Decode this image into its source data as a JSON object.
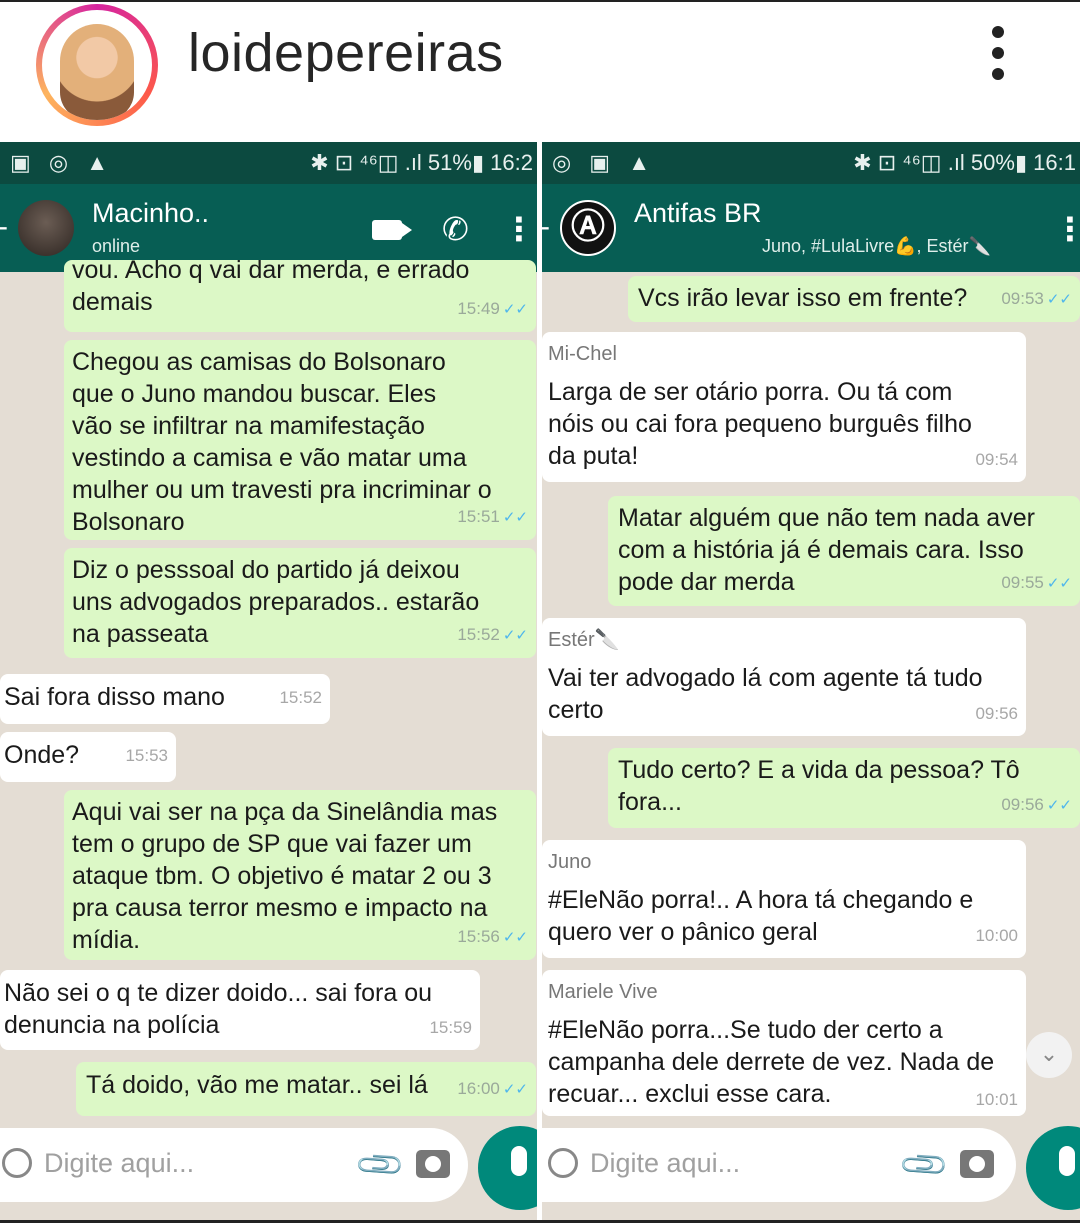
{
  "post": {
    "username": "loidepereiras"
  },
  "left": {
    "status": {
      "left_icons": "▣ ◎ ▲",
      "right": "✱ ⊡ ⁴⁶◫ .ıl 51%▮ 16:2"
    },
    "header": {
      "name": "Macinho..",
      "subtitle": "online"
    },
    "messages": [
      {
        "text": "vou. Acho q vai dar merda, e errado\ndemais",
        "time": "15:49"
      },
      {
        "text": "Chegou as camisas do Bolsonaro\nque o Juno mandou buscar. Eles\nvão se infiltrar na mamifestação\nvestindo a camisa e vão matar uma\nmulher ou um travesti pra incriminar o\nBolsonaro",
        "time": "15:51"
      },
      {
        "text": "Diz o pesssoal do partido já deixou\nuns advogados preparados.. estarão\nna passeata",
        "time": "15:52"
      },
      {
        "text": "Sai fora disso mano",
        "time": "15:52"
      },
      {
        "text": "Onde?",
        "time": "15:53"
      },
      {
        "text": "Aqui vai ser na pça da Sinelândia mas\ntem o grupo de SP que vai fazer um\nataque tbm. O objetivo é matar 2 ou 3\npra causa terror mesmo e impacto na\nmídia.",
        "time": "15:56"
      },
      {
        "text": "Não sei o q te dizer doido... sai fora ou\ndenuncia na polícia",
        "time": "15:59"
      },
      {
        "text": "Tá doido, vão me matar.. sei lá",
        "time": "16:00"
      }
    ],
    "input_placeholder": "Digite aqui..."
  },
  "right": {
    "status": {
      "left_icons": "◎ ▣ ▲",
      "right": "✱ ⊡ ⁴⁶◫ .ıl 50%▮ 16:1"
    },
    "header": {
      "name": "Antifas BR",
      "subtitle": "Juno, #LulaLivre💪, Estér🔪",
      "avatar_glyph": "Ⓐ"
    },
    "messages": [
      {
        "text": "Vcs irão levar isso em frente?",
        "time": "09:53"
      },
      {
        "sender": "Mi-Chel",
        "text": "Larga de ser otário porra. Ou tá com\nnóis ou cai fora pequeno burguês filho\nda puta!",
        "time": "09:54"
      },
      {
        "text": "Matar alguém que não tem nada aver\ncom a história já é demais cara. Isso\npode dar merda",
        "time": "09:55"
      },
      {
        "sender": "Estér🔪",
        "text": "Vai ter advogado lá com agente tá tudo\ncerto",
        "time": "09:56"
      },
      {
        "text": "Tudo certo? E a vida da pessoa? Tô\nfora...",
        "time": "09:56"
      },
      {
        "sender": "Juno",
        "text": "#EleNão porra!.. A hora tá chegando e\nquero ver o pânico geral",
        "time": "10:00"
      },
      {
        "sender": "Mariele Vive",
        "text": "#EleNão porra...Se tudo der certo a\ncampanha dele derrete de vez. Nada de\nrecuar... exclui esse cara.",
        "time": "10:01"
      }
    ],
    "input_placeholder": "Digite aqui..."
  },
  "colors": {
    "header": "#075e54",
    "statusbar": "#0c4a40",
    "outgoing": "#dcf8c6",
    "incoming": "#ffffff",
    "chat_bg": "#e4ddd4",
    "mic": "#00897b"
  },
  "icons": [
    "more-vertical-icon",
    "video-call-icon",
    "phone-icon",
    "menu-icon",
    "smiley-icon",
    "attach-icon",
    "camera-icon",
    "mic-icon",
    "scroll-down-icon",
    "read-check-icon"
  ]
}
